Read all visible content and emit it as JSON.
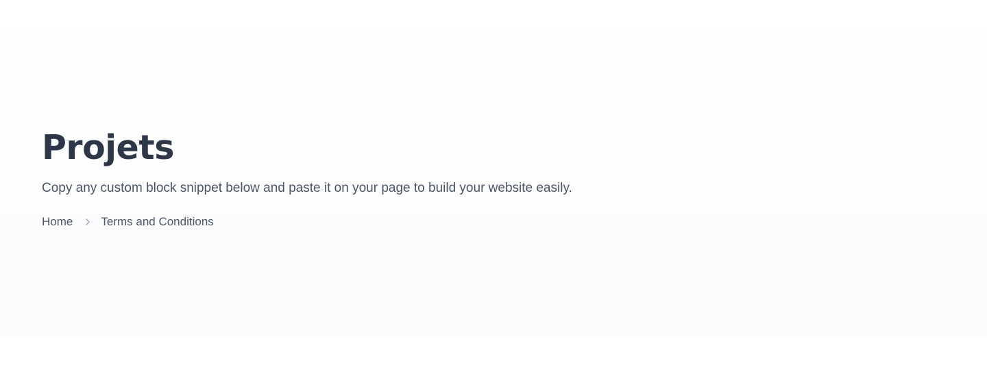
{
  "hero": {
    "title": "Projets",
    "subtitle": "Copy any custom block snippet below and paste it on your page to build your website easily."
  },
  "breadcrumb": {
    "items": [
      {
        "label": "Home"
      },
      {
        "label": "Terms and Conditions"
      }
    ],
    "separator_icon": "chevron-right-icon"
  },
  "colors": {
    "title": "#2d3748",
    "text": "#4a5568",
    "separator": "#9aa4b2",
    "background": "#ffffff"
  }
}
